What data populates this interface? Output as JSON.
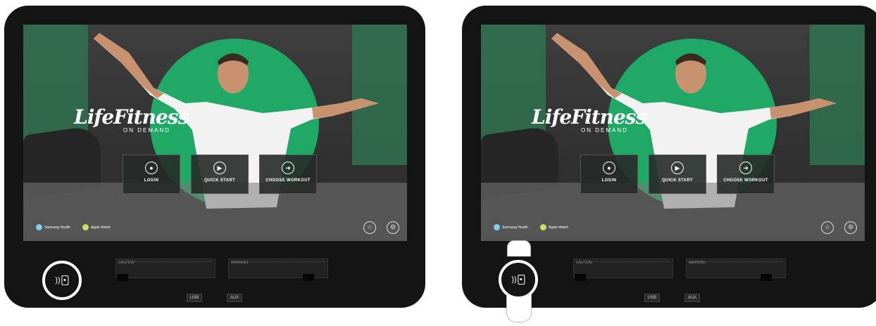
{
  "brand": {
    "name": "LifeFitness",
    "subtitle": "ON DEMAND"
  },
  "tiles": [
    {
      "label": "LOGIN",
      "icon": "user-icon"
    },
    {
      "label": "QUICK START",
      "icon": "play-icon"
    },
    {
      "label": "CHOOSE WORKOUT",
      "icon": "runner-icon"
    }
  ],
  "badges": {
    "samsung": {
      "text": "Samsung Health",
      "color": "#7fd0f0"
    },
    "apple": {
      "text": "Apple Watch",
      "color": "#c8e05a"
    }
  },
  "warnings": {
    "caution_title": "CAUTION",
    "warning_title": "WARNING"
  },
  "ports": {
    "usb": "USB",
    "audio": "AUX"
  },
  "colors": {
    "accent_green": "#1fa866",
    "bezel": "#141414",
    "highlight_ring": "#ffffff"
  },
  "icons": {
    "nfc": "nfc-contactless-icon",
    "round_left": "star-icon",
    "round_right": "gear-icon"
  }
}
